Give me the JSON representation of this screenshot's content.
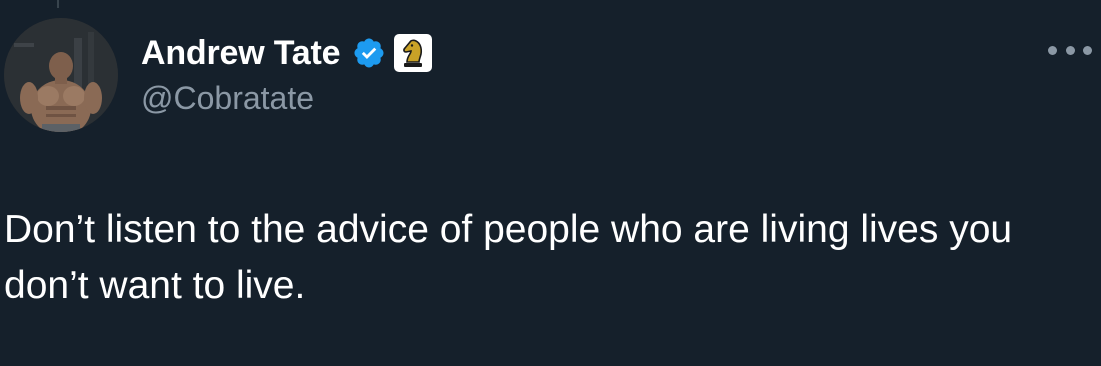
{
  "tweet": {
    "display_name": "Andrew Tate",
    "handle": "@Cobratate",
    "text": "Don’t listen to the advice of people who are living lives you don’t want to live.",
    "verified_icon": "verified-badge-icon",
    "affiliate_badge_icon": "chess-knight-icon",
    "more_icon": "more-options-icon"
  },
  "colors": {
    "background": "#15202b",
    "primary_text": "#ffffff",
    "secondary_text": "#8b98a5",
    "verified_blue": "#1d9bf0"
  }
}
